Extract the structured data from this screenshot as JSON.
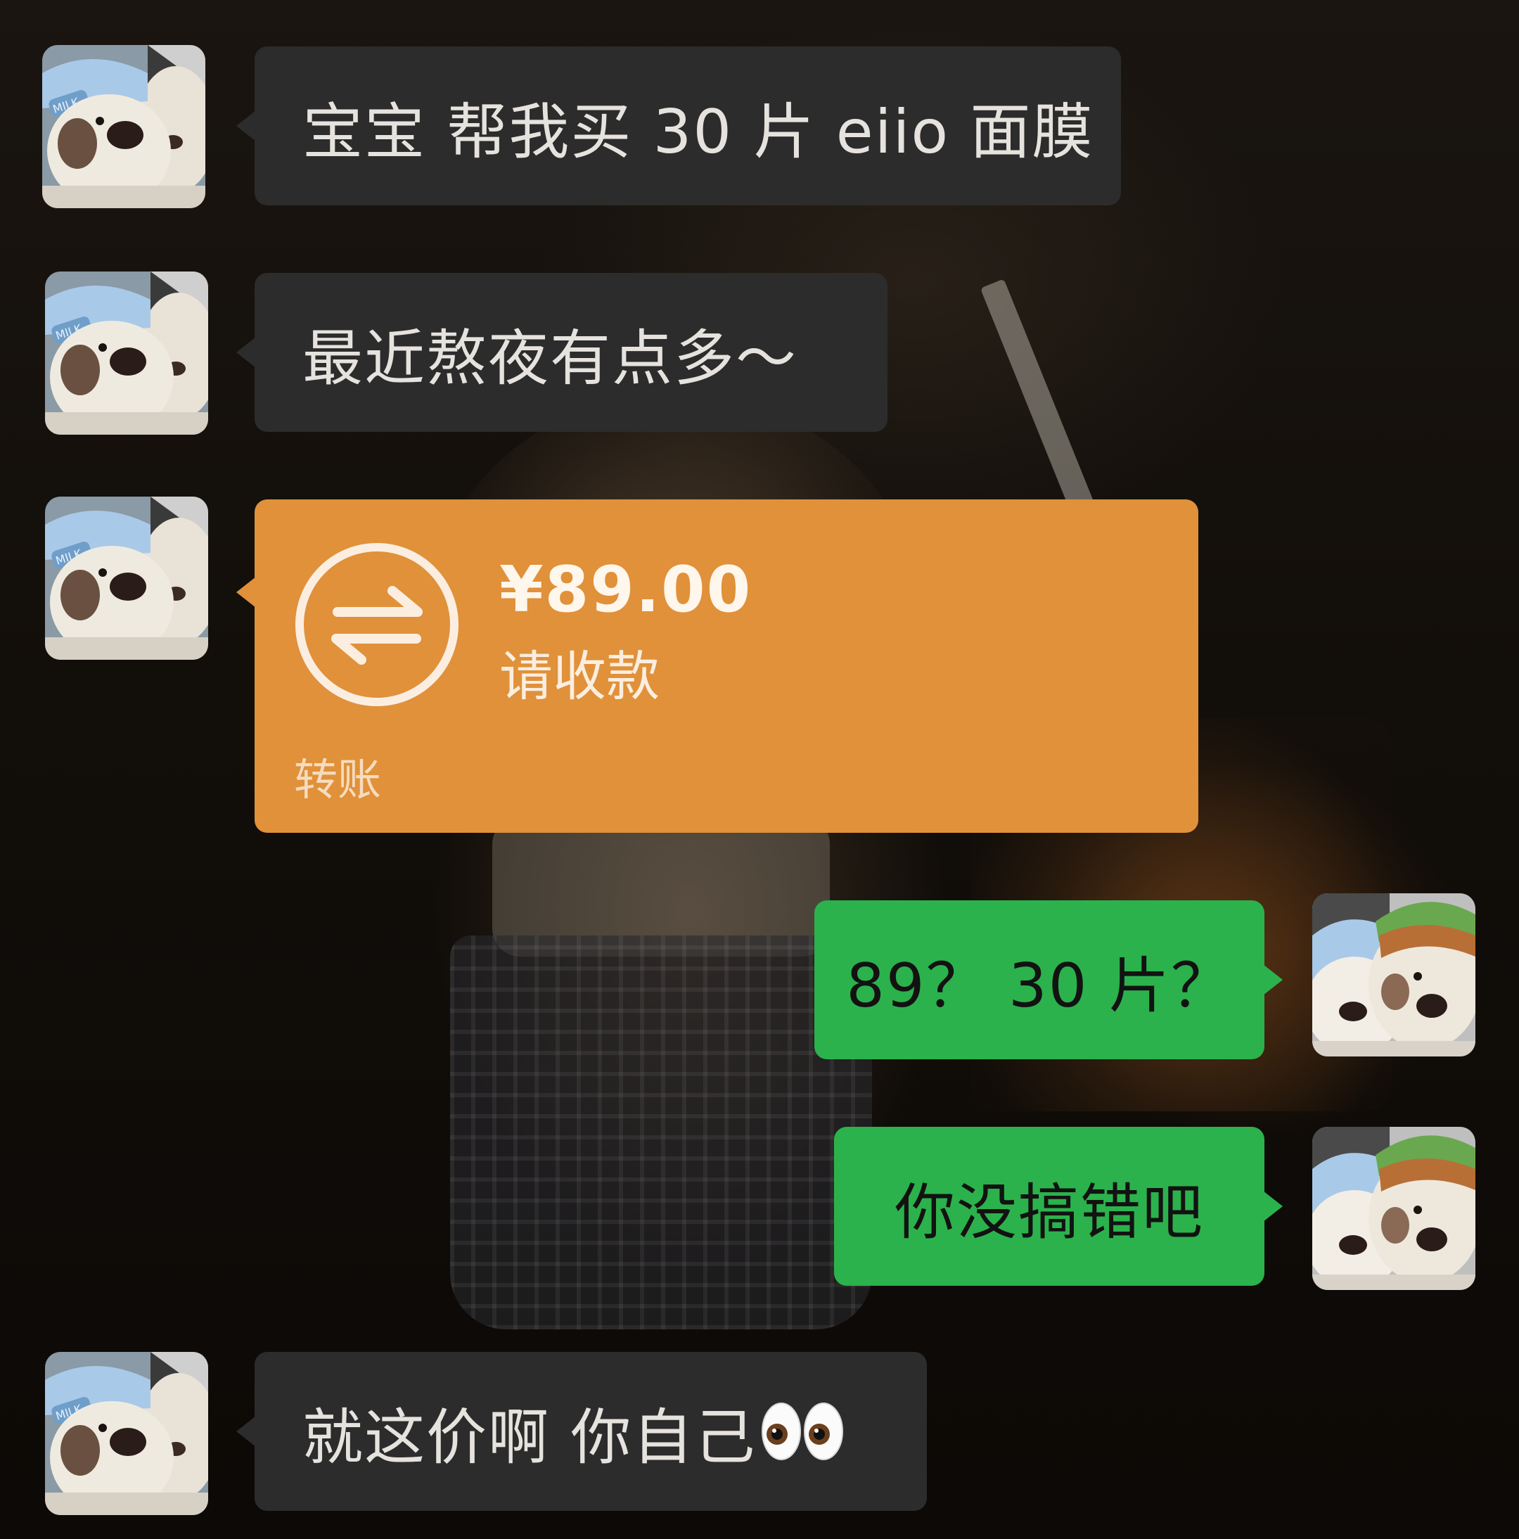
{
  "messages": [
    {
      "side": "left",
      "type": "text",
      "text": "宝宝 帮我买 30 片 eiio 面膜"
    },
    {
      "side": "left",
      "type": "text",
      "text": "最近熬夜有点多～"
    },
    {
      "side": "left",
      "type": "transfer",
      "amount": "¥89.00",
      "status": "请收款",
      "label": "转账"
    },
    {
      "side": "right",
      "type": "text",
      "text": "89？ 30 片？"
    },
    {
      "side": "right",
      "type": "text",
      "text": "你没搞错吧"
    },
    {
      "side": "left",
      "type": "text",
      "text": "就这价啊 你自己",
      "emoji": "eyes-emoji"
    }
  ],
  "colors": {
    "incoming_bubble": "#2c2c2c",
    "outgoing_bubble": "#2bb24c",
    "transfer_bubble": "#e0913a"
  }
}
